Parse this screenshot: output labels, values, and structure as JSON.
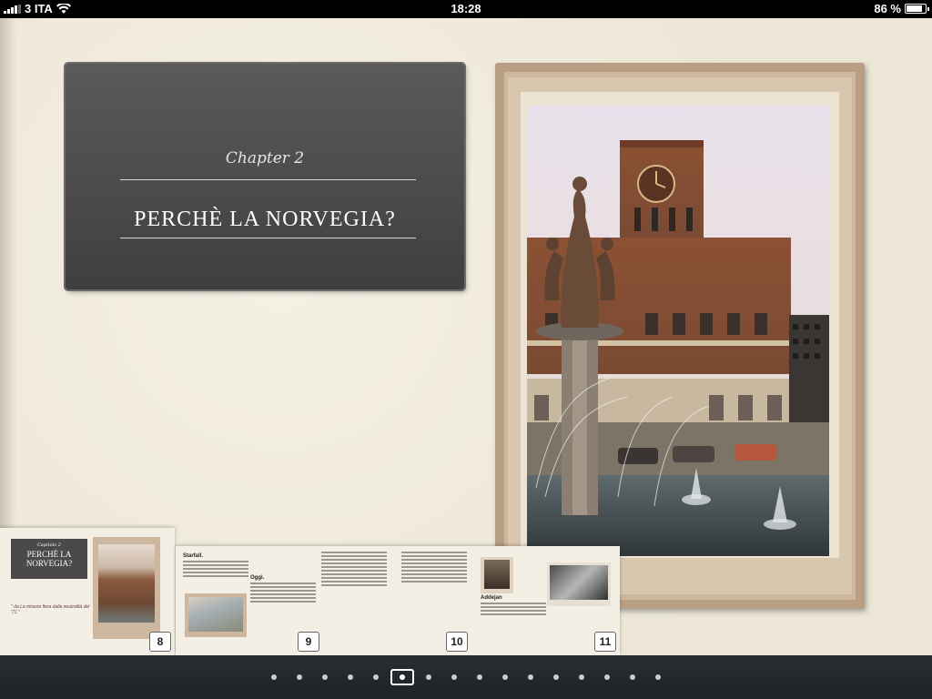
{
  "status_bar": {
    "carrier": "3 ITA",
    "time": "18:28",
    "battery_text": "86 %",
    "battery_level": 0.86
  },
  "chapter_page": {
    "chapter_label": "Chapter 2",
    "title": "PERCHÈ LA NORVEGIA?"
  },
  "thumbnails": {
    "page_numbers": [
      "8",
      "9",
      "10",
      "11"
    ],
    "mini_chapter": "Capitolo 2",
    "mini_title": "PERCHÈ LA NORVEGIA?",
    "quote": "\" da La miseria fiera dalla neutralità del '71 \"",
    "sections": [
      "Starfall.",
      "Oggi.",
      "Addejan"
    ]
  },
  "page_dots": {
    "count": 16,
    "active_index": 5
  },
  "colors": {
    "paper": "#efeadc",
    "title_card": "#4a4a4d",
    "frame": "#cdb79e",
    "dock": "#23262b"
  }
}
